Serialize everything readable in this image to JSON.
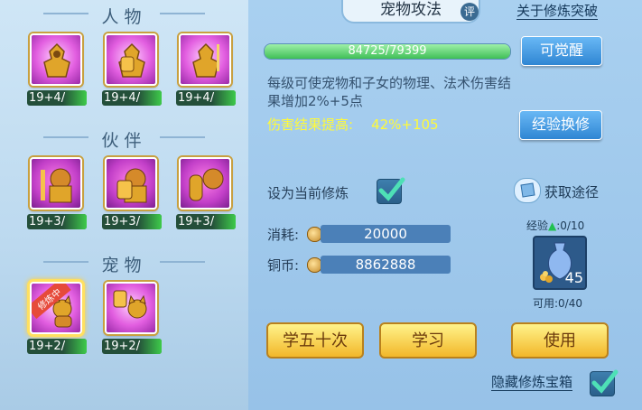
{
  "sections": {
    "people": "人物",
    "partners": "伙伴",
    "pets": "宠物"
  },
  "people_slots": [
    {
      "level": "19+4/",
      "icon": "golden-warrior-icon"
    },
    {
      "level": "19+4/",
      "icon": "golden-warrior-shield-icon"
    },
    {
      "level": "19+4/",
      "icon": "golden-warrior-sword-icon"
    }
  ],
  "partner_slots": [
    {
      "level": "19+3/",
      "icon": "golden-lion-warrior-icon"
    },
    {
      "level": "19+3/",
      "icon": "golden-lion-shield-icon"
    },
    {
      "level": "19+3/",
      "icon": "golden-lion-arm-icon"
    }
  ],
  "pet_slots": [
    {
      "level": "19+2/",
      "icon": "cat-pet-icon",
      "badge": "修炼中"
    },
    {
      "level": "19+2/",
      "icon": "cat-pet-shield-icon"
    }
  ],
  "header": {
    "tab": "宠物攻法",
    "eval": "评",
    "breakthrough_link": "关于修炼突破"
  },
  "progress": {
    "text": "84725/79399",
    "fraction": 1.0
  },
  "awaken_button": "可觉醒",
  "description": "每级可使宠物和子女的物理、法术伤害结果增加2%+5点",
  "bonus": {
    "label": "伤害结果提高:",
    "value": "42%+105"
  },
  "exchange_button": "经验换修",
  "set_current": "设为当前修炼",
  "get_way": "获取途径",
  "cost": {
    "label": "消耗:",
    "value": "20000"
  },
  "copper": {
    "label": "铜币:",
    "value": "8862888"
  },
  "exp": {
    "label": "经验",
    "value": ":0/10"
  },
  "item": {
    "count": "45",
    "usable": "可用:0/40"
  },
  "buttons": {
    "learn50": "学五十次",
    "learn": "学习",
    "use": "使用"
  },
  "hide_box": "隐藏修炼宝箱",
  "colors": {
    "gold_button": "#f2b72a",
    "blue_button": "#2f86d3",
    "highlight_text": "#fffa3a",
    "progress_fill": "#3fbf57"
  }
}
